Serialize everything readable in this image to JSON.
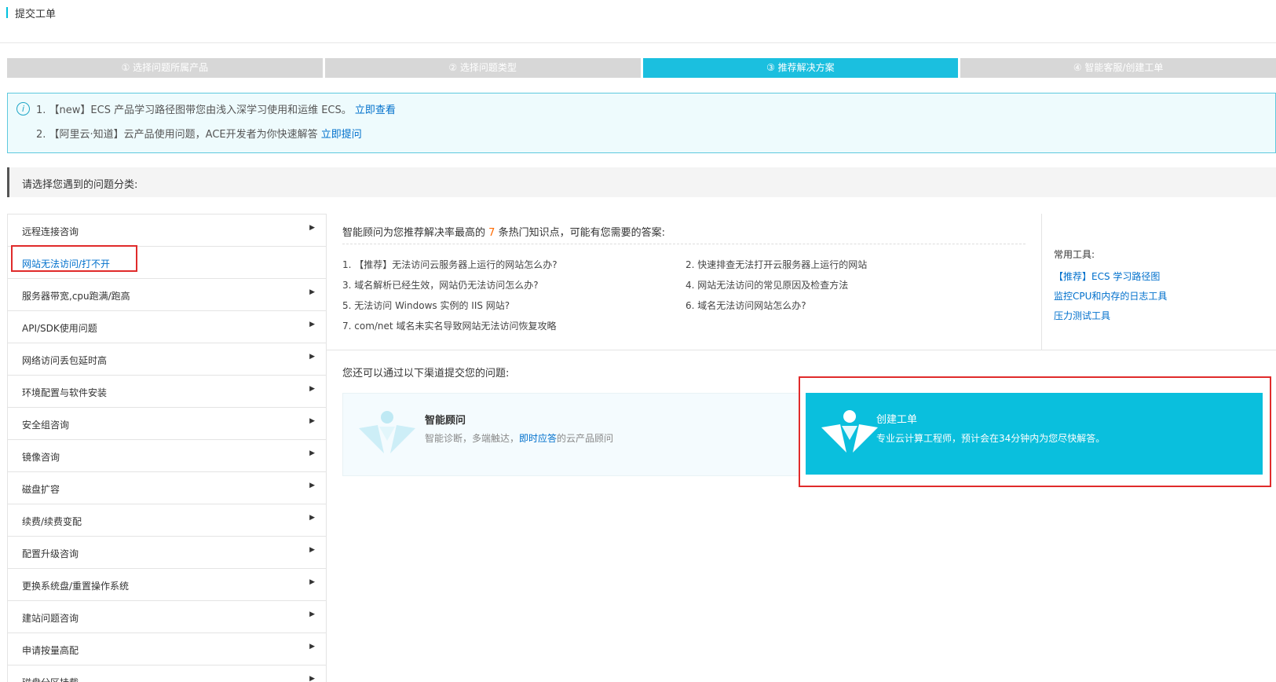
{
  "header": {
    "title": "提交工单"
  },
  "steps": [
    {
      "label": "① 选择问题所属产品",
      "active": false
    },
    {
      "label": "② 选择问题类型",
      "active": false
    },
    {
      "label": "③ 推荐解决方案",
      "active": true
    },
    {
      "label": "④ 智能客服/创建工单",
      "active": false
    }
  ],
  "notice": {
    "icon": "info-icon",
    "line1_text": "1. 【new】ECS 产品学习路径图带您由浅入深学习使用和运维 ECS。",
    "line1_link": "立即查看",
    "line2_text": "2. 【阿里云·知道】云产品使用问题，ACE开发者为你快速解答",
    "line2_link": "立即提问"
  },
  "category_header": "请选择您遇到的问题分类:",
  "sidebar": {
    "items": [
      {
        "label": "远程连接咨询"
      },
      {
        "label": "网站无法访问/打不开"
      },
      {
        "label": "服务器带宽,cpu跑满/跑高"
      },
      {
        "label": "API/SDK使用问题"
      },
      {
        "label": "网络访问丢包延时高"
      },
      {
        "label": "环境配置与软件安装"
      },
      {
        "label": "安全组咨询"
      },
      {
        "label": "镜像咨询"
      },
      {
        "label": "磁盘扩容"
      },
      {
        "label": "续费/续费变配"
      },
      {
        "label": "配置升级咨询"
      },
      {
        "label": "更换系统盘/重置操作系统"
      },
      {
        "label": "建站问题咨询"
      },
      {
        "label": "申请按量高配"
      },
      {
        "label": "磁盘分区挂载"
      }
    ]
  },
  "recommend": {
    "title_prefix": "智能顾问为您推荐解决率最高的",
    "count": "7",
    "title_suffix": "条热门知识点，可能有您需要的答案:",
    "items": [
      "1. 【推荐】无法访问云服务器上运行的网站怎么办?",
      "2. 快速排查无法打开云服务器上运行的网站",
      "3. 域名解析已经生效，网站仍无法访问怎么办?",
      "4. 网站无法访问的常见原因及检查方法",
      "5. 无法访问 Windows 实例的 IIS 网站?",
      "6. 域名无法访问网站怎么办?",
      "7. com/net 域名未实名导致网站无法访问恢复攻略"
    ]
  },
  "tools": {
    "title": "常用工具:",
    "links": [
      "【推荐】ECS 学习路径图",
      "监控CPU和内存的日志工具",
      "压力测试工具"
    ]
  },
  "channels": {
    "title": "您还可以通过以下渠道提交您的问题:",
    "ai": {
      "icon": "assistant-logo-icon",
      "title": "智能顾问",
      "desc_prefix": "智能诊断，多端触达，",
      "desc_link": "即时应答",
      "desc_suffix": "的云产品顾问"
    },
    "ticket": {
      "icon": "ticket-logo-icon",
      "title": "创建工单",
      "desc": "专业云计算工程师，预计会在34分钟内为您尽快解答。"
    }
  },
  "colors": {
    "accent": "#1bbfdf",
    "ticket_bg": "#0abfdd",
    "highlight_border": "#e02b2b",
    "link": "#0070cc",
    "count": "#ff6a00"
  }
}
